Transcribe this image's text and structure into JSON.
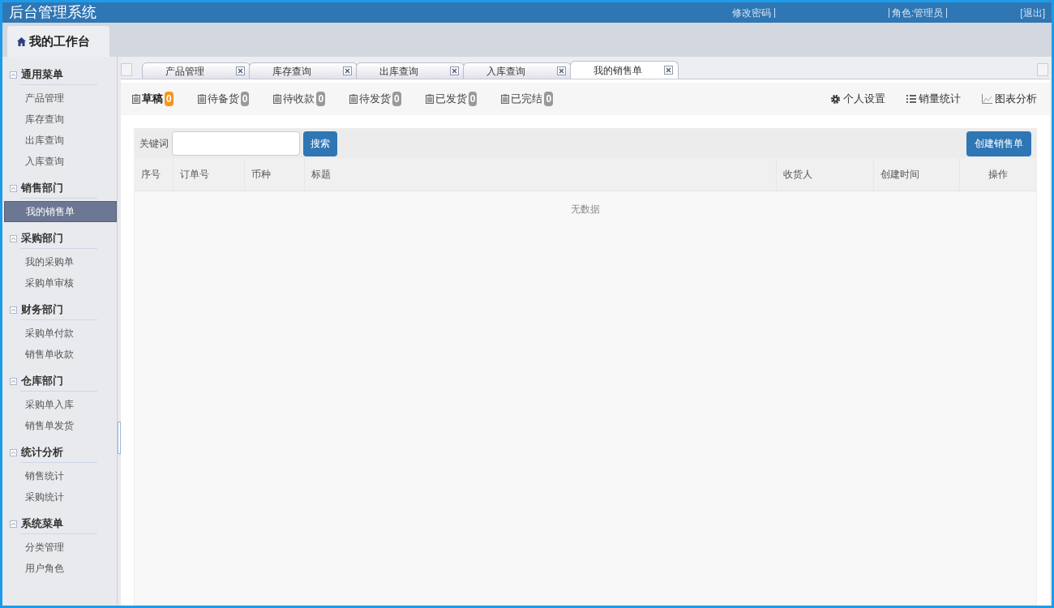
{
  "header": {
    "title": "后台管理系统",
    "links": [
      {
        "label": "修改密码"
      },
      {
        "label": "角色:管理员"
      },
      {
        "label": "[退出]"
      }
    ]
  },
  "workbench_tab": {
    "label": "我的工作台"
  },
  "sidebar": {
    "groups": [
      {
        "title": "通用菜单",
        "expanded": true,
        "items": [
          {
            "label": "产品管理",
            "selected": false
          },
          {
            "label": "库存查询",
            "selected": false
          },
          {
            "label": "出库查询",
            "selected": false
          },
          {
            "label": "入库查询",
            "selected": false
          }
        ]
      },
      {
        "title": "销售部门",
        "expanded": true,
        "items": [
          {
            "label": "我的销售单",
            "selected": true
          }
        ]
      },
      {
        "title": "采购部门",
        "expanded": true,
        "items": [
          {
            "label": "我的采购单",
            "selected": false
          },
          {
            "label": "采购单审核",
            "selected": false
          }
        ]
      },
      {
        "title": "财务部门",
        "expanded": true,
        "items": [
          {
            "label": "采购单付款",
            "selected": false
          },
          {
            "label": "销售单收款",
            "selected": false
          }
        ]
      },
      {
        "title": "仓库部门",
        "expanded": true,
        "items": [
          {
            "label": "采购单入库",
            "selected": false
          },
          {
            "label": "销售单发货",
            "selected": false
          }
        ]
      },
      {
        "title": "统计分析",
        "expanded": true,
        "items": [
          {
            "label": "销售统计",
            "selected": false
          },
          {
            "label": "采购统计",
            "selected": false
          }
        ]
      },
      {
        "title": "系统菜单",
        "expanded": true,
        "items": [
          {
            "label": "分类管理",
            "selected": false
          },
          {
            "label": "用户角色",
            "selected": false
          }
        ]
      }
    ]
  },
  "tabs": [
    {
      "label": "产品管理",
      "selected": false
    },
    {
      "label": "库存查询",
      "selected": false
    },
    {
      "label": "出库查询",
      "selected": false
    },
    {
      "label": "入库查询",
      "selected": false
    },
    {
      "label": "我的销售单",
      "selected": true
    }
  ],
  "status_tabs": [
    {
      "label": "草稿",
      "count": "0",
      "selected": true
    },
    {
      "label": "待备货",
      "count": "0",
      "selected": false
    },
    {
      "label": "待收款",
      "count": "0",
      "selected": false
    },
    {
      "label": "待发货",
      "count": "0",
      "selected": false
    },
    {
      "label": "已发货",
      "count": "0",
      "selected": false
    },
    {
      "label": "已完结",
      "count": "0",
      "selected": false
    }
  ],
  "tools": [
    {
      "kind": "settings",
      "label": "个人设置"
    },
    {
      "kind": "list",
      "label": "销量统计"
    },
    {
      "kind": "chart",
      "label": "图表分析"
    }
  ],
  "search": {
    "label": "关键词",
    "button": "搜索"
  },
  "create_button": "创建销售单",
  "table": {
    "columns": [
      "序号",
      "订单号",
      "币种",
      "标题",
      "收货人",
      "创建时间",
      "操作"
    ],
    "empty_text": "无数据"
  }
}
